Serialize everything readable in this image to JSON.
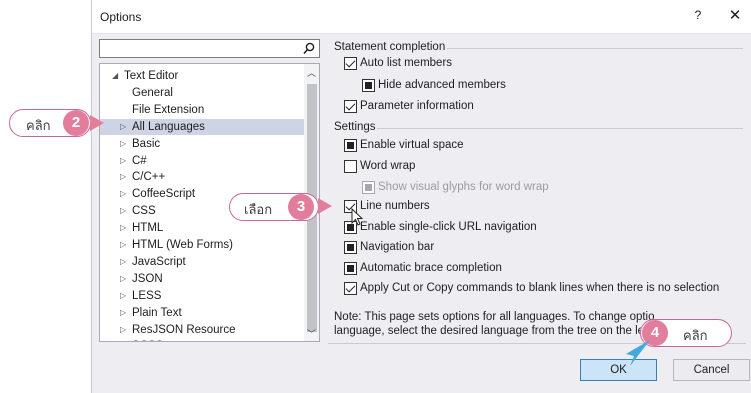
{
  "dialog": {
    "title": "Options",
    "help_label": "?",
    "close_label": "✕"
  },
  "search": {
    "value": "",
    "placeholder": ""
  },
  "tree": {
    "items": [
      {
        "label": "Text Editor",
        "glyph": "◢",
        "expanded": true
      },
      {
        "label": "General",
        "glyph": ""
      },
      {
        "label": "File Extension",
        "glyph": ""
      },
      {
        "label": "All Languages",
        "glyph": "▷",
        "selected": true
      },
      {
        "label": "Basic",
        "glyph": "▷"
      },
      {
        "label": "C#",
        "glyph": "▷"
      },
      {
        "label": "C/C++",
        "glyph": "▷"
      },
      {
        "label": "CoffeeScript",
        "glyph": "▷"
      },
      {
        "label": "CSS",
        "glyph": "▷"
      },
      {
        "label": "HTML",
        "glyph": "▷"
      },
      {
        "label": "HTML (Web Forms)",
        "glyph": "▷"
      },
      {
        "label": "JavaScript",
        "glyph": "▷"
      },
      {
        "label": "JSON",
        "glyph": "▷"
      },
      {
        "label": "LESS",
        "glyph": "▷"
      },
      {
        "label": "Plain Text",
        "glyph": "▷"
      },
      {
        "label": "ResJSON Resource",
        "glyph": "▷"
      },
      {
        "label": "SCSS",
        "glyph": "▷"
      }
    ]
  },
  "statement_completion": {
    "header": "Statement completion",
    "auto_list_members": {
      "label": "Auto list members",
      "state": "checked"
    },
    "hide_advanced_members": {
      "label": "Hide advanced members",
      "state": "indeterminate"
    },
    "parameter_information": {
      "label": "Parameter information",
      "state": "checked"
    }
  },
  "settings": {
    "header": "Settings",
    "enable_virtual_space": {
      "label": "Enable virtual space",
      "state": "indeterminate"
    },
    "word_wrap": {
      "label": "Word wrap",
      "state": "unchecked"
    },
    "show_visual_glyphs": {
      "label": "Show visual glyphs for word wrap",
      "state": "indeterminate",
      "disabled": true
    },
    "line_numbers": {
      "label": "Line numbers",
      "state": "checked"
    },
    "single_click_url": {
      "label": "Enable single-click URL navigation",
      "state": "indeterminate"
    },
    "navigation_bar": {
      "label": "Navigation bar",
      "state": "indeterminate"
    },
    "brace_completion": {
      "label": "Automatic brace completion",
      "state": "indeterminate"
    },
    "apply_cut_copy": {
      "label": "Apply Cut or Copy commands to blank lines when there is no selection",
      "state": "checked"
    }
  },
  "note": {
    "line1": "Note: This page sets options for all languages. To change optio",
    "line2": "language, select the desired language from the tree on the lef"
  },
  "buttons": {
    "ok": "OK",
    "cancel": "Cancel"
  },
  "annotations": {
    "step2": {
      "number": "2",
      "text": "คลิก"
    },
    "step3": {
      "number": "3",
      "text": "เลือก"
    },
    "step4": {
      "number": "4",
      "text": "คลิก"
    }
  },
  "colors": {
    "annotation_pink": "#e27d9c",
    "annotation_border": "#c8679d",
    "selection": "#cfd3e6",
    "ok_button": "#cce4f7",
    "pointer_blue": "#3fa9e0"
  }
}
